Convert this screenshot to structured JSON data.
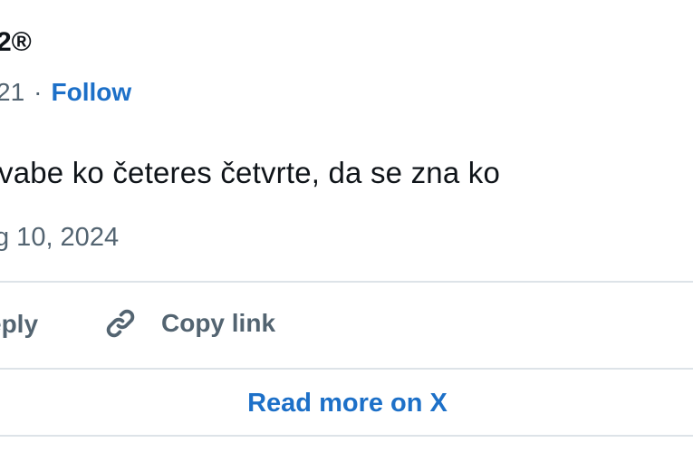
{
  "tweet": {
    "username_visible": "2®",
    "handle_visible_tail": "21",
    "separator": "·",
    "follow_label": "Follow",
    "text_visible": "vabe ko četeres četvrte, da se zna ko",
    "timestamp_visible": "g 10, 2024"
  },
  "actions": {
    "reply_label_visible": "eply",
    "copy_link_label": "Copy link",
    "copy_link_icon": "link-icon"
  },
  "footer": {
    "read_more_label": "Read more on X"
  },
  "colors": {
    "text": "#0f1419",
    "muted": "#536471",
    "link": "#1d70c8",
    "divider": "#dde3e8"
  }
}
